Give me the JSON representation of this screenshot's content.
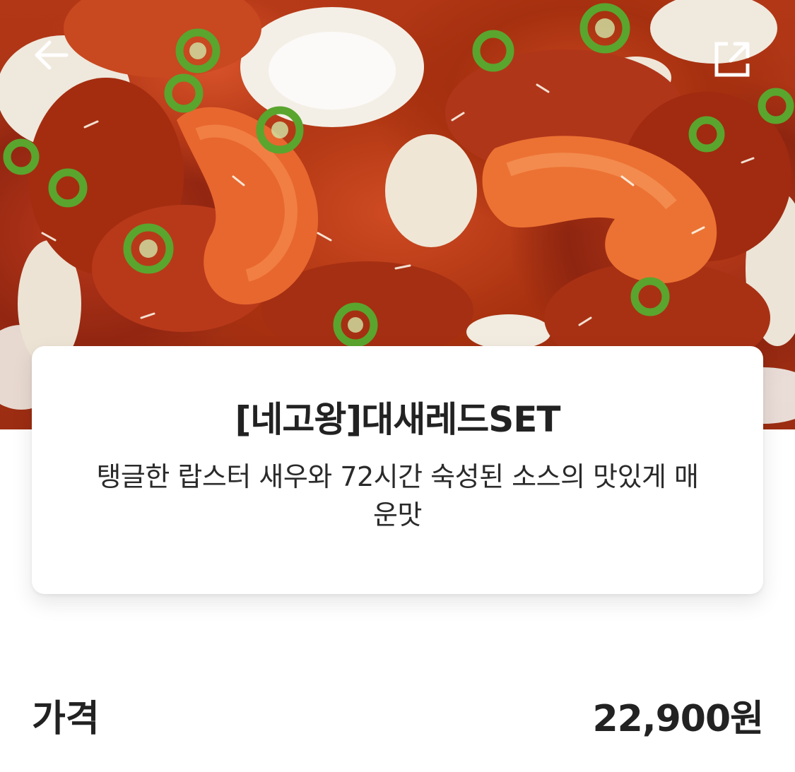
{
  "header": {
    "back_icon": "arrow-left-icon",
    "share_icon": "share-external-icon"
  },
  "product": {
    "name": "[네고왕]대새레드SET",
    "description": "탱글한 랍스터 새우와 72시간 숙성된 소스의 맛있게 매운맛",
    "image_alt": "Spicy red sauce fried chicken with shrimp and green chili"
  },
  "price": {
    "label": "가격",
    "value": "22,900원"
  },
  "colors": {
    "sauce": "#b23716",
    "chili": "#5aa52e",
    "text": "#222222",
    "card_bg": "#ffffff"
  }
}
